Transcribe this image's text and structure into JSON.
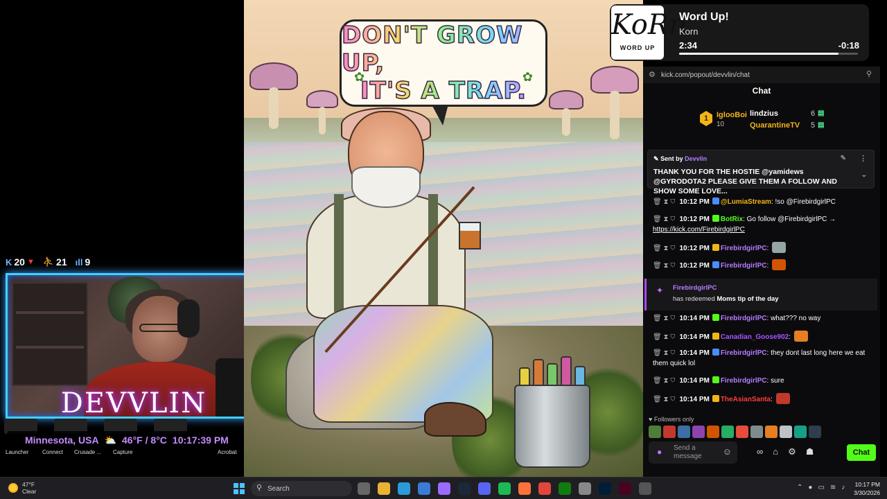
{
  "stream_stats": {
    "kick_count": "20",
    "followers_count": "21",
    "viewers_count": "9"
  },
  "webcam": {
    "logo_text": "DEVVLIN"
  },
  "weather_bar": {
    "location": "Minnesota, USA",
    "temp": "46°F / 8°C",
    "time": "10:17:39 PM"
  },
  "desktop_labels": [
    "Launcher",
    "Connect",
    "Crusade ...",
    "Capture",
    "Acrobat"
  ],
  "artwork": {
    "bubble_line1": "DON'T GROW UP,",
    "bubble_line2": "IT'S A TRAP."
  },
  "now_playing": {
    "cover_logo": "KoRn",
    "cover_caption": "WORD UP",
    "title": "Word Up!",
    "artist": "Korn",
    "elapsed": "2:34",
    "remaining": "-0:18",
    "progress_fraction": 0.89
  },
  "chat": {
    "url": "kick.com/popout/devvlin/chat",
    "header": "Chat",
    "leaderboard": {
      "first": {
        "rank": "1",
        "name": "IglooBoi",
        "count": "10"
      },
      "others": [
        {
          "name": "lindzius",
          "count": "6",
          "color": "#ffffff"
        },
        {
          "name": "QuarantineTV",
          "count": "5",
          "color": "#f2b418"
        }
      ]
    },
    "pinned": {
      "sent_by_label": "Sent by",
      "user": "Devvlin",
      "text": "THANK YOU FOR THE HOSTIE @yamidews @GYRODOTA2 PLEASE GIVE THEM A FOLLOW AND SHOW SOME LOVE..."
    },
    "messages": [
      {
        "time": "10:12 PM",
        "user": "@LumiaStream",
        "user_color": "#f2b418",
        "text": "!so @FirebirdgirlPC"
      },
      {
        "time": "10:12 PM",
        "user": "BotRix",
        "user_color": "#53fc18",
        "text": "Go follow @FirebirdgirlPC →",
        "link": "https://kick.com/FirebirdgirlPC"
      },
      {
        "time": "10:12 PM",
        "user": "FirebirdgirlPC",
        "user_color": "#b77cff",
        "text": ""
      },
      {
        "time": "10:12 PM",
        "user": "FirebirdgirlPC",
        "user_color": "#b77cff",
        "text": ""
      },
      {
        "time": "10:14 PM",
        "user": "FirebirdgirlPC",
        "user_color": "#b77cff",
        "text": "what??? no way"
      },
      {
        "time": "10:14 PM",
        "user": "Canadian_Goose902",
        "user_color": "#a855ff",
        "text": ""
      },
      {
        "time": "10:14 PM",
        "user": "FirebirdgirlPC",
        "user_color": "#b77cff",
        "text": "they dont last long here we eat them quick lol"
      },
      {
        "time": "10:14 PM",
        "user": "FirebirdgirlPC",
        "user_color": "#b77cff",
        "text": "sure"
      },
      {
        "time": "10:14 PM",
        "user": "TheAsianSanta",
        "user_color": "#ff3b3b",
        "text": ""
      }
    ],
    "redeem": {
      "user": "FirebirdgirlPC",
      "prefix": "has redeemed",
      "reward": "Moms tip of the day"
    },
    "followers_only": "Followers only",
    "composer_placeholder": "Send a message",
    "send_label": "Chat",
    "accent": "#53fc18"
  },
  "taskbar": {
    "weather_temp": "47°F",
    "weather_cond": "Clear",
    "search_placeholder": "Search",
    "clock_time": "10:17 PM",
    "clock_date": "3/30/2026"
  }
}
